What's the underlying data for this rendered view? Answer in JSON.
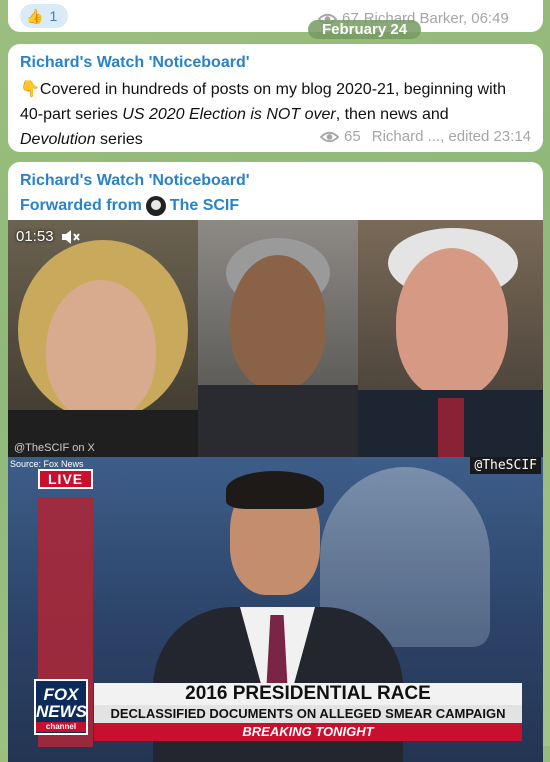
{
  "prev_message": {
    "reaction": {
      "emoji": "👍",
      "count": "1"
    },
    "views": "67",
    "author_time": "Richard Barker, 06:49"
  },
  "date_separator": "February 24",
  "message2": {
    "sender": "Richard's Watch 'Noticeboard'",
    "text_lead": "👇Covered in hundreds of posts on my blog 2020-21, beginning with 40-part series ",
    "text_italic1": "US 2020 Election is NOT over",
    "text_mid": ", then news and ",
    "text_italic2": "Devolution",
    "text_end": " series",
    "views": "65",
    "footer": "Richard ..., edited 23:14"
  },
  "message3": {
    "sender": "Richard's Watch 'Noticeboard'",
    "forwarded_prefix": "Forwarded from",
    "forwarded_source": "The SCIF",
    "video": {
      "duration": "01:53",
      "watermark_top": "@TheSCIF on X",
      "watermark_badge": "@TheSCIF",
      "source_note": "Source: Fox News",
      "live_label": "LIVE",
      "network_logo_line1": "FOX",
      "network_logo_line2": "NEWS",
      "network_logo_line3": "channel",
      "chyron_title": "2016 PRESIDENTIAL RACE",
      "chyron_subtitle": "DECLASSIFIED DOCUMENTS ON ALLEGED SMEAR CAMPAIGN",
      "chyron_breaking": "BREAKING TONIGHT"
    }
  }
}
